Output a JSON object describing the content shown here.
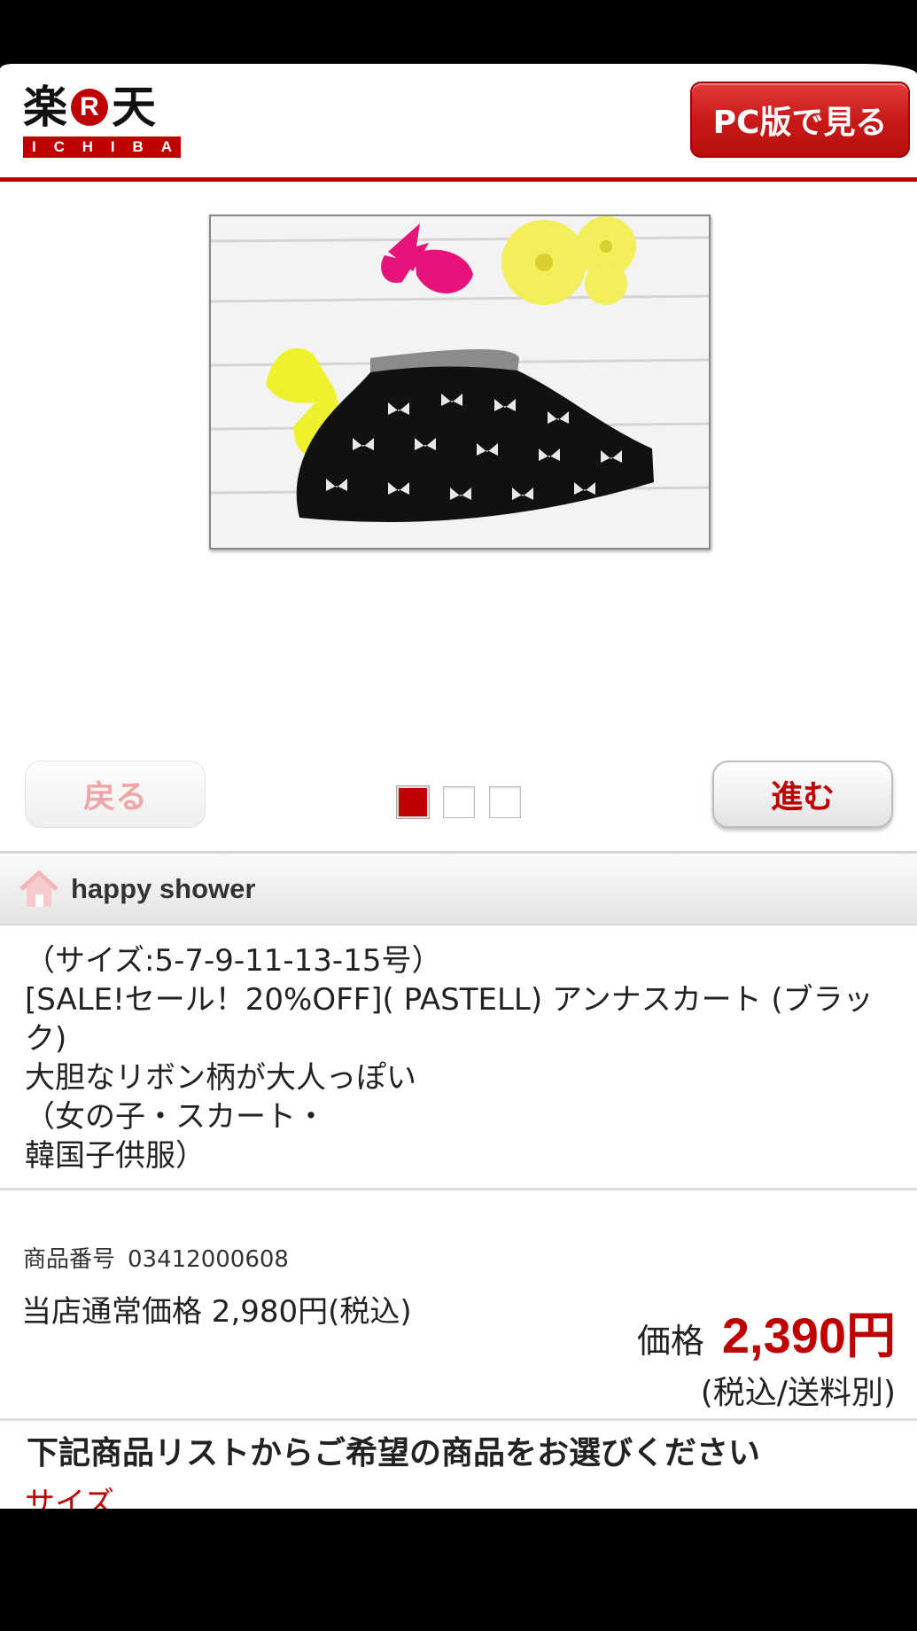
{
  "header": {
    "logo_kanji_left": "楽",
    "logo_r": "R",
    "logo_kanji_right": "天",
    "logo_sub": [
      "I",
      "C",
      "H",
      "I",
      "B",
      "A"
    ],
    "pc_button": "PC版で見る"
  },
  "carousel": {
    "back_label": "戻る",
    "next_label": "進む",
    "page_count": 3,
    "active_index": 0
  },
  "shop": {
    "name": "happy shower"
  },
  "product": {
    "title_lines": [
      "（サイズ:5-7-9-11-13-15号）",
      "[SALE!セール！20%OFF]( PASTELL) アンナスカート (ブラック)",
      "大胆なリボン柄が大人っぽい",
      "（女の子・スカート・",
      "韓国子供服）"
    ],
    "item_no_label": "商品番号",
    "item_no": "03412000608",
    "normal_price": "当店通常価格 2,980円(税込)",
    "price_label": "価格",
    "price": "2,390円",
    "price_note": "(税込/送料別)"
  },
  "selection": {
    "heading": "下記商品リストからご希望の商品をお選びください",
    "size_label": "サイズ"
  },
  "colors": {
    "brand_red": "#bf0000"
  }
}
